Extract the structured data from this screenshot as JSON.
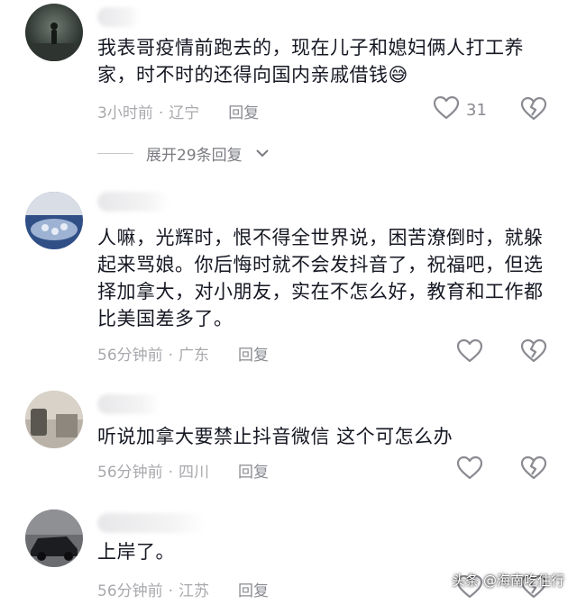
{
  "comments": [
    {
      "text": "我表哥疫情前跑去的，现在儿子和媳妇俩人打工养家，时不时的还得向国内亲戚借钱😅",
      "time": "3小时前",
      "separator": "·",
      "location": "辽宁",
      "reply_label": "回复",
      "like_count": "31",
      "expand_label": "展开29条回复"
    },
    {
      "text": "人嘛，光辉时，恨不得全世界说，困苦潦倒时，就躲起来骂娘。你后悔时就不会发抖音了，祝福吧，但选择加拿大，对小朋友，实在不怎么好，教育和工作都比美国差多了。",
      "time": "56分钟前",
      "separator": "·",
      "location": "广东",
      "reply_label": "回复"
    },
    {
      "text": "听说加拿大要禁止抖音微信  这个可怎么办",
      "time": "56分钟前",
      "separator": "·",
      "location": "四川",
      "reply_label": "回复"
    },
    {
      "text": "上岸了。",
      "time": "56分钟前",
      "separator": "·",
      "location": "江苏",
      "reply_label": "回复"
    }
  ],
  "watermark": "头条 @海南吃住行",
  "icons": {
    "like": "heart-outline-icon",
    "dislike": "broken-heart-icon",
    "expand": "chevron-down-icon"
  },
  "colors": {
    "text": "#161823",
    "meta": "#a8a9ad",
    "icon": "#8a8b91"
  }
}
